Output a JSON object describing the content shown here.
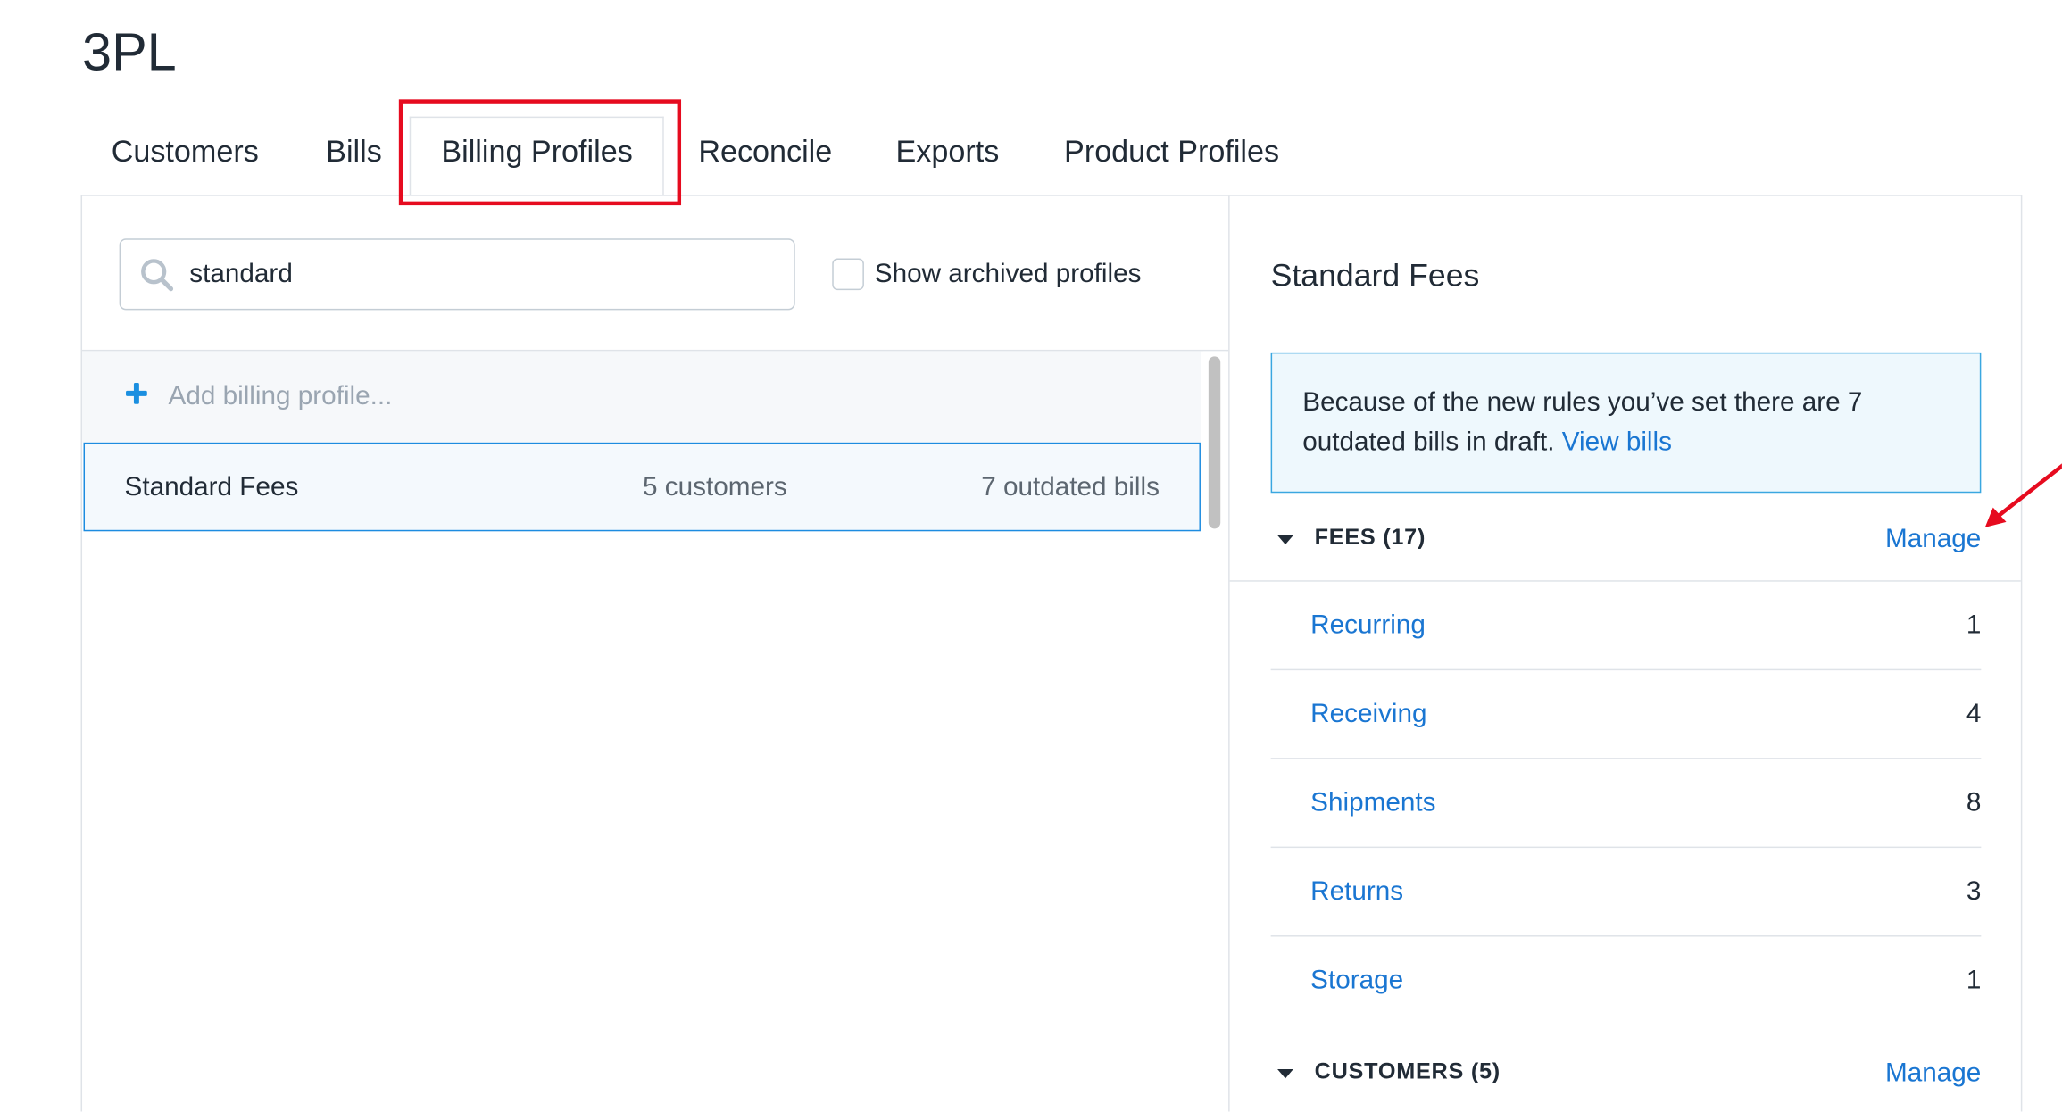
{
  "app": {
    "title": "3PL"
  },
  "tabs": [
    {
      "label": "Customers"
    },
    {
      "label": "Bills"
    },
    {
      "label": "Billing Profiles"
    },
    {
      "label": "Reconcile"
    },
    {
      "label": "Exports"
    },
    {
      "label": "Product Profiles"
    }
  ],
  "active_tab": "Billing Profiles",
  "search": {
    "value": "standard",
    "icon": "search-icon"
  },
  "archived_filter": {
    "label": "Show archived profiles",
    "checked": false
  },
  "add_profile": {
    "label": "Add billing profile...",
    "icon": "plus-icon"
  },
  "profiles": [
    {
      "name": "Standard Fees",
      "customers": "5 customers",
      "outdated": "7 outdated bills"
    }
  ],
  "detail": {
    "title": "Standard Fees",
    "notice": {
      "text": "Because of the new rules you’ve set there are 7 outdated bills in draft.",
      "link": "View bills"
    },
    "fees_section": {
      "label": "FEES (17)",
      "manage": "Manage"
    },
    "fees": [
      {
        "name": "Recurring",
        "count": "1"
      },
      {
        "name": "Receiving",
        "count": "4"
      },
      {
        "name": "Shipments",
        "count": "8"
      },
      {
        "name": "Returns",
        "count": "3"
      },
      {
        "name": "Storage",
        "count": "1"
      }
    ],
    "customers_section": {
      "label": "CUSTOMERS (5)",
      "manage": "Manage"
    }
  },
  "colors": {
    "link": "#1a76d2",
    "annotation": "#e60b1f",
    "selected_border": "#1d8ce0",
    "notice_border": "#3aa7e0",
    "accent_plus": "#1a8fe0"
  }
}
